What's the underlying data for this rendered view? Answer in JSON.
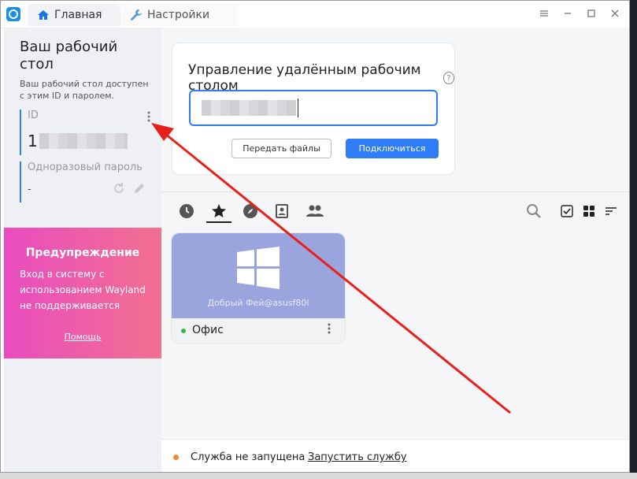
{
  "window": {
    "tabs": [
      {
        "label": "Главная",
        "icon": "home-icon"
      },
      {
        "label": "Настройки",
        "icon": "wrench-icon"
      }
    ],
    "controls": [
      "pin-icon",
      "menu-icon",
      "minimize-icon",
      "maximize-icon",
      "close-icon"
    ]
  },
  "left_panel": {
    "title": "Ваш рабочий стол",
    "subtitle": "Ваш рабочий стол доступен с этим ID и паролем.",
    "id_label": "ID",
    "id_value_visible": "1",
    "password_label": "Одноразовый пароль",
    "password_value": "-"
  },
  "warning": {
    "title": "Предупреждение",
    "text": "Вход в систему с использованием Wayland не поддерживается",
    "link": "Помощь"
  },
  "connect": {
    "title": "Управление удалённым рабочим столом",
    "transfer_button": "Передать файлы",
    "connect_button": "Подключиться"
  },
  "peer_tabs": [
    "recent-icon",
    "favorites-icon",
    "discovered-icon",
    "address-book-icon",
    "group-icon"
  ],
  "peer_toolbar_right": [
    "search-icon",
    "select-icon",
    "grid-view-icon",
    "sort-icon"
  ],
  "peers": [
    {
      "user": "Добрый Фей@asusf80l",
      "name": "Офис",
      "online": true
    }
  ],
  "status": {
    "text": "Служба не запущена",
    "link": "Запустить службу"
  },
  "colors": {
    "accent": "#2e7cf6",
    "warning_gradient_start": "#e94cc0",
    "warning_gradient_end": "#f27090",
    "peer_thumb": "#9aa5dd",
    "annotation_arrow": "#e8201b"
  }
}
